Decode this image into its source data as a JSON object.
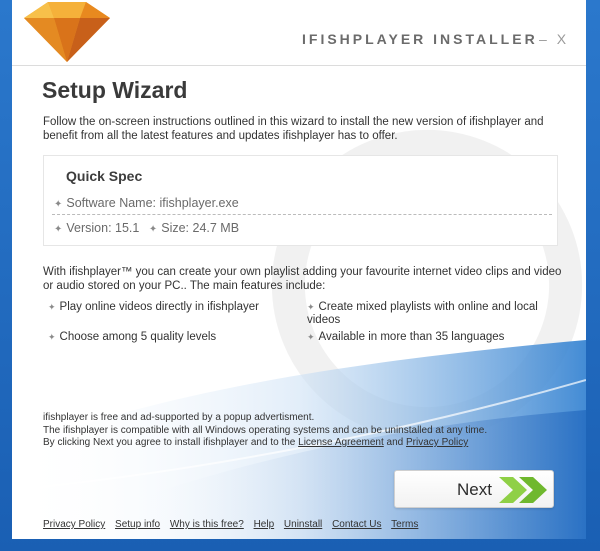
{
  "window": {
    "title": "IFISHPLAYER INSTALLER",
    "minimize": "–",
    "close": "X"
  },
  "header": {
    "heading": "Setup Wizard",
    "intro": "Follow the on-screen instructions outlined in this wizard to install the new version of ifishplayer and benefit from all the latest features and updates ifishplayer has to offer."
  },
  "spec": {
    "title": "Quick Spec",
    "software_name": "Software Name: ifishplayer.exe",
    "version": "Version: 15.1",
    "size": "Size: 24.7 MB"
  },
  "description": "With ifishplayer™ you can create your own playlist adding your favourite internet video clips and video or audio stored on your PC.. The main features include:",
  "features": [
    "Play online videos directly in ifishplayer",
    "Create mixed playlists with online and local videos",
    "Choose among 5 quality levels",
    "Available in more than 35 languages"
  ],
  "legal": {
    "line1": "ifishplayer is free and ad-supported by a popup advertisment.",
    "line2": "The ifishplayer is compatible with all Windows operating systems and can be uninstalled at any time.",
    "line3_prefix": "By clicking Next you agree to install ifishplayer and to the",
    "license_link": "License Agreement",
    "and": "and",
    "privacy_link": "Privacy Policy"
  },
  "buttons": {
    "next": "Next"
  },
  "footer": {
    "links": [
      "Privacy Policy",
      "Setup info",
      "Why is this free?",
      "Help",
      "Uninstall",
      "Contact Us",
      "Terms"
    ]
  },
  "colors": {
    "frame": "#1c64b8",
    "accent_green": "#7cc43a",
    "logo_orange": "#f0a030"
  }
}
